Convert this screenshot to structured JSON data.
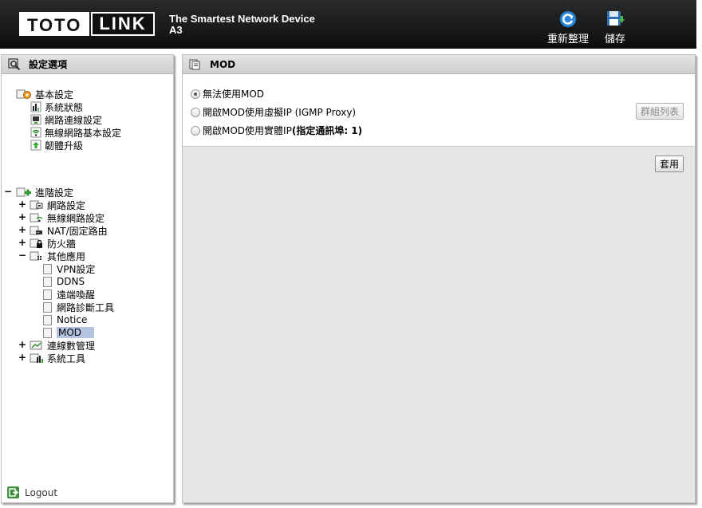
{
  "header": {
    "logo_left": "TOTO",
    "logo_right": "LINK",
    "tagline": "The Smartest Network Device",
    "model": "A3",
    "reboot_label": "重新整理",
    "save_label": "儲存"
  },
  "sidebar": {
    "title": "設定選項",
    "basic": {
      "label": "基本設定",
      "items": [
        "系統狀態",
        "網路連線設定",
        "無線網路基本設定",
        "韌體升級"
      ]
    },
    "advanced": {
      "toggle": "−",
      "label": "進階設定",
      "items": [
        {
          "toggle": "+",
          "label": "網路設定"
        },
        {
          "toggle": "+",
          "label": "無線網路設定"
        },
        {
          "toggle": "+",
          "label": "NAT/固定路由"
        },
        {
          "toggle": "+",
          "label": "防火牆"
        },
        {
          "toggle": "−",
          "label": "其他應用"
        }
      ],
      "other_items": [
        "VPN設定",
        "DDNS",
        "遠端喚醒",
        "網路診斷工具",
        "Notice",
        "MOD"
      ],
      "tail_items": [
        {
          "toggle": "+",
          "label": "連線數管理"
        },
        {
          "toggle": "+",
          "label": "系統工具"
        }
      ]
    },
    "logout": "Logout"
  },
  "main": {
    "title": "MOD",
    "options": [
      {
        "label": "無法使用MOD",
        "selected": true
      },
      {
        "label": "開啟MOD使用虛擬IP (IGMP Proxy)",
        "selected": false
      },
      {
        "label_prefix": "開啟MOD使用實體IP ",
        "label_bold": "(指定通訊埠: 1)",
        "selected": false
      }
    ],
    "group_list_button": "群組列表",
    "apply_button": "套用"
  },
  "colors": {
    "header_bg": "#1a1a1a",
    "selected_bg": "#b4c4e0",
    "panel_bg": "#e6e6e6"
  }
}
